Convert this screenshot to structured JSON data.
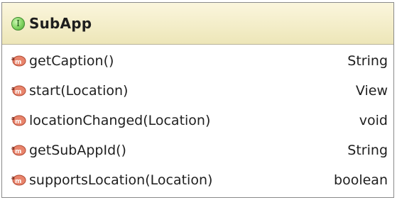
{
  "class": {
    "name": "SubApp",
    "kind_icon": "interface-icon",
    "kind_letter": "I"
  },
  "methods": [
    {
      "name": "getCaption()",
      "return_type": "String",
      "icon": "abstract-method-icon"
    },
    {
      "name": "start(Location)",
      "return_type": "View",
      "icon": "abstract-method-icon"
    },
    {
      "name": "locationChanged(Location)",
      "return_type": "void",
      "icon": "abstract-method-icon"
    },
    {
      "name": "getSubAppId()",
      "return_type": "String",
      "icon": "abstract-method-icon"
    },
    {
      "name": "supportsLocation(Location)",
      "return_type": "boolean",
      "icon": "abstract-method-icon"
    }
  ],
  "colors": {
    "header_bg": "#f4eec8",
    "interface_icon": "#7fd35f",
    "method_icon": "#e07a62",
    "border": "#8a8a8a"
  }
}
